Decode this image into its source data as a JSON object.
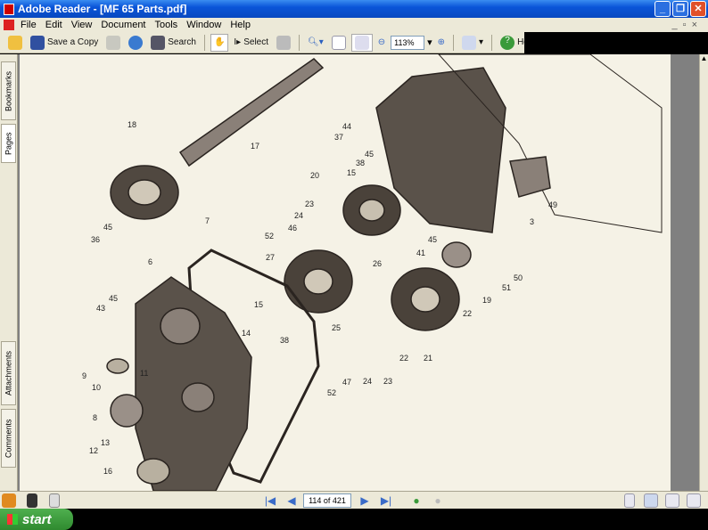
{
  "window": {
    "title": "Adobe Reader - [MF 65 Parts.pdf]"
  },
  "menu": [
    "File",
    "Edit",
    "View",
    "Document",
    "Tools",
    "Window",
    "Help"
  ],
  "toolbar": {
    "save_copy": "Save a Copy",
    "search": "Search",
    "select": "Select",
    "zoom": "113%",
    "help": "Help"
  },
  "left_tabs": {
    "bookmarks": "Bookmarks",
    "pages": "Pages",
    "attachments": "Attachments",
    "comments": "Comments"
  },
  "status": {
    "page": "114 of 421"
  },
  "taskbar": {
    "start": "start"
  },
  "diagram_labels": [
    "18",
    "17",
    "44",
    "37",
    "45",
    "38",
    "15",
    "20",
    "23",
    "24",
    "46",
    "52",
    "45",
    "41",
    "26",
    "27",
    "3",
    "49",
    "50",
    "51",
    "19",
    "22",
    "25",
    "22",
    "21",
    "23",
    "24",
    "47",
    "52",
    "36",
    "45",
    "7",
    "6",
    "15",
    "14",
    "38",
    "45",
    "43",
    "9",
    "10",
    "11",
    "8",
    "13",
    "12",
    "16"
  ]
}
